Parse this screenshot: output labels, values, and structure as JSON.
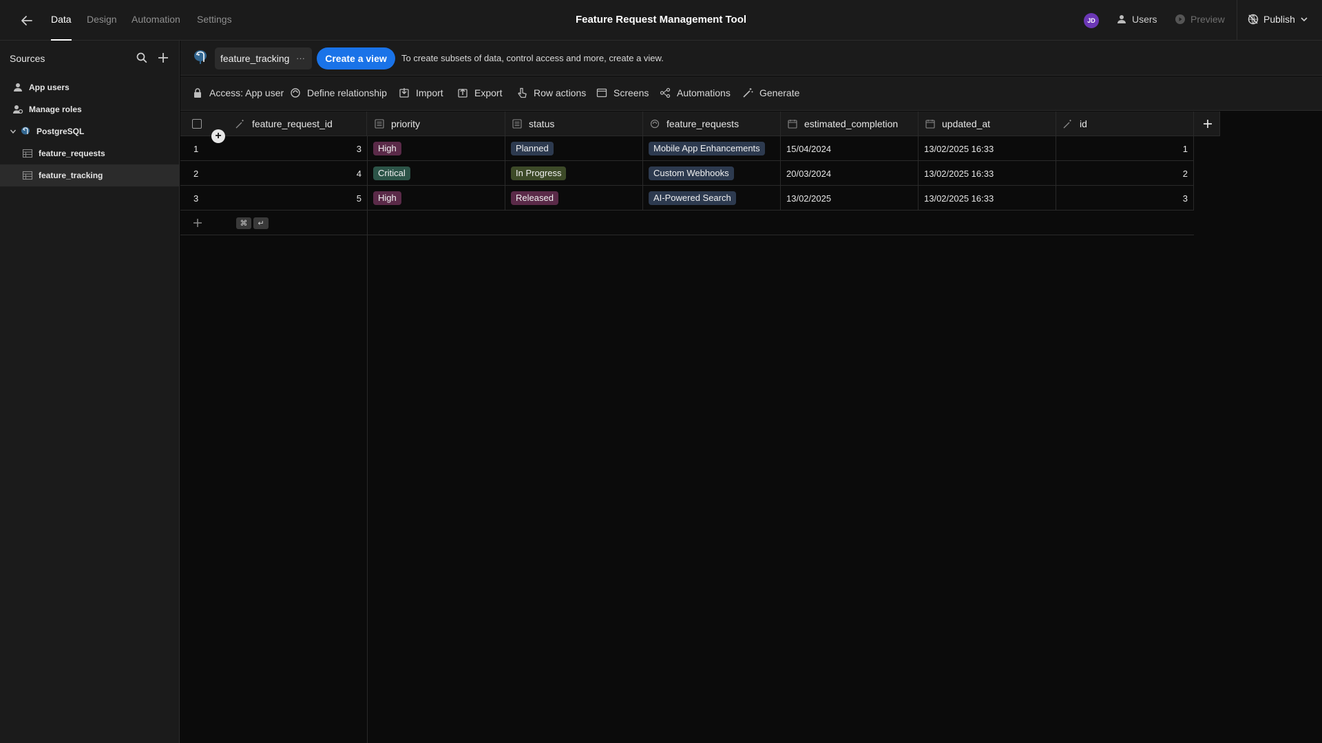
{
  "header": {
    "title": "Feature Request Management Tool",
    "tabs": [
      {
        "label": "Data"
      },
      {
        "label": "Design"
      },
      {
        "label": "Automation"
      },
      {
        "label": "Settings"
      }
    ],
    "avatar_initials": "JD",
    "users_label": "Users",
    "preview_label": "Preview",
    "publish_label": "Publish"
  },
  "sidebar": {
    "title": "Sources",
    "items": [
      {
        "label": "App users",
        "icon": "user-icon"
      },
      {
        "label": "Manage roles",
        "icon": "roles-icon"
      },
      {
        "label": "PostgreSQL",
        "icon": "postgresql-icon"
      },
      {
        "label": "feature_requests",
        "icon": "table-icon"
      },
      {
        "label": "feature_tracking",
        "icon": "table-icon",
        "selected": true
      }
    ]
  },
  "content_header": {
    "table_name": "feature_tracking",
    "more_label": "···",
    "create_view_label": "Create a view",
    "hint": "To create subsets of data, control access and more, create a view."
  },
  "toolbar": {
    "access": "Access: App user",
    "define_relationship": "Define relationship",
    "import": "Import",
    "export": "Export",
    "row_actions": "Row actions",
    "screens": "Screens",
    "automations": "Automations",
    "generate": "Generate"
  },
  "table": {
    "columns": [
      {
        "label": "feature_request_id",
        "icon": "auto-id-icon"
      },
      {
        "label": "priority",
        "icon": "options-icon"
      },
      {
        "label": "status",
        "icon": "options-icon"
      },
      {
        "label": "feature_requests",
        "icon": "link-icon"
      },
      {
        "label": "estimated_completion",
        "icon": "calendar-icon"
      },
      {
        "label": "updated_at",
        "icon": "calendar-icon"
      },
      {
        "label": "id",
        "icon": "auto-id-icon"
      }
    ],
    "rows": [
      {
        "num": "1",
        "feature_request_id": "3",
        "priority": "High",
        "status": "Planned",
        "feature_requests": "Mobile App Enhancements",
        "estimated_completion": "15/04/2024",
        "updated_at": "13/02/2025 16:33",
        "id": "1"
      },
      {
        "num": "2",
        "feature_request_id": "4",
        "priority": "Critical",
        "status": "In Progress",
        "feature_requests": "Custom Webhooks",
        "estimated_completion": "20/03/2024",
        "updated_at": "13/02/2025 16:33",
        "id": "2"
      },
      {
        "num": "3",
        "feature_request_id": "5",
        "priority": "High",
        "status": "Released",
        "feature_requests": "AI-Powered Search",
        "estimated_completion": "13/02/2025",
        "updated_at": "13/02/2025 16:33",
        "id": "3"
      }
    ],
    "shortcut_keys": [
      "⌘",
      "↵"
    ]
  },
  "colors": {
    "accent": "#1a73e8",
    "pill_high": "#5a2a48",
    "pill_critical": "#2c5448",
    "pill_planned": "#2d3a4f",
    "pill_in_progress": "#3d4a28",
    "pill_released": "#5a2a48",
    "pill_link": "#2d3a4f"
  }
}
